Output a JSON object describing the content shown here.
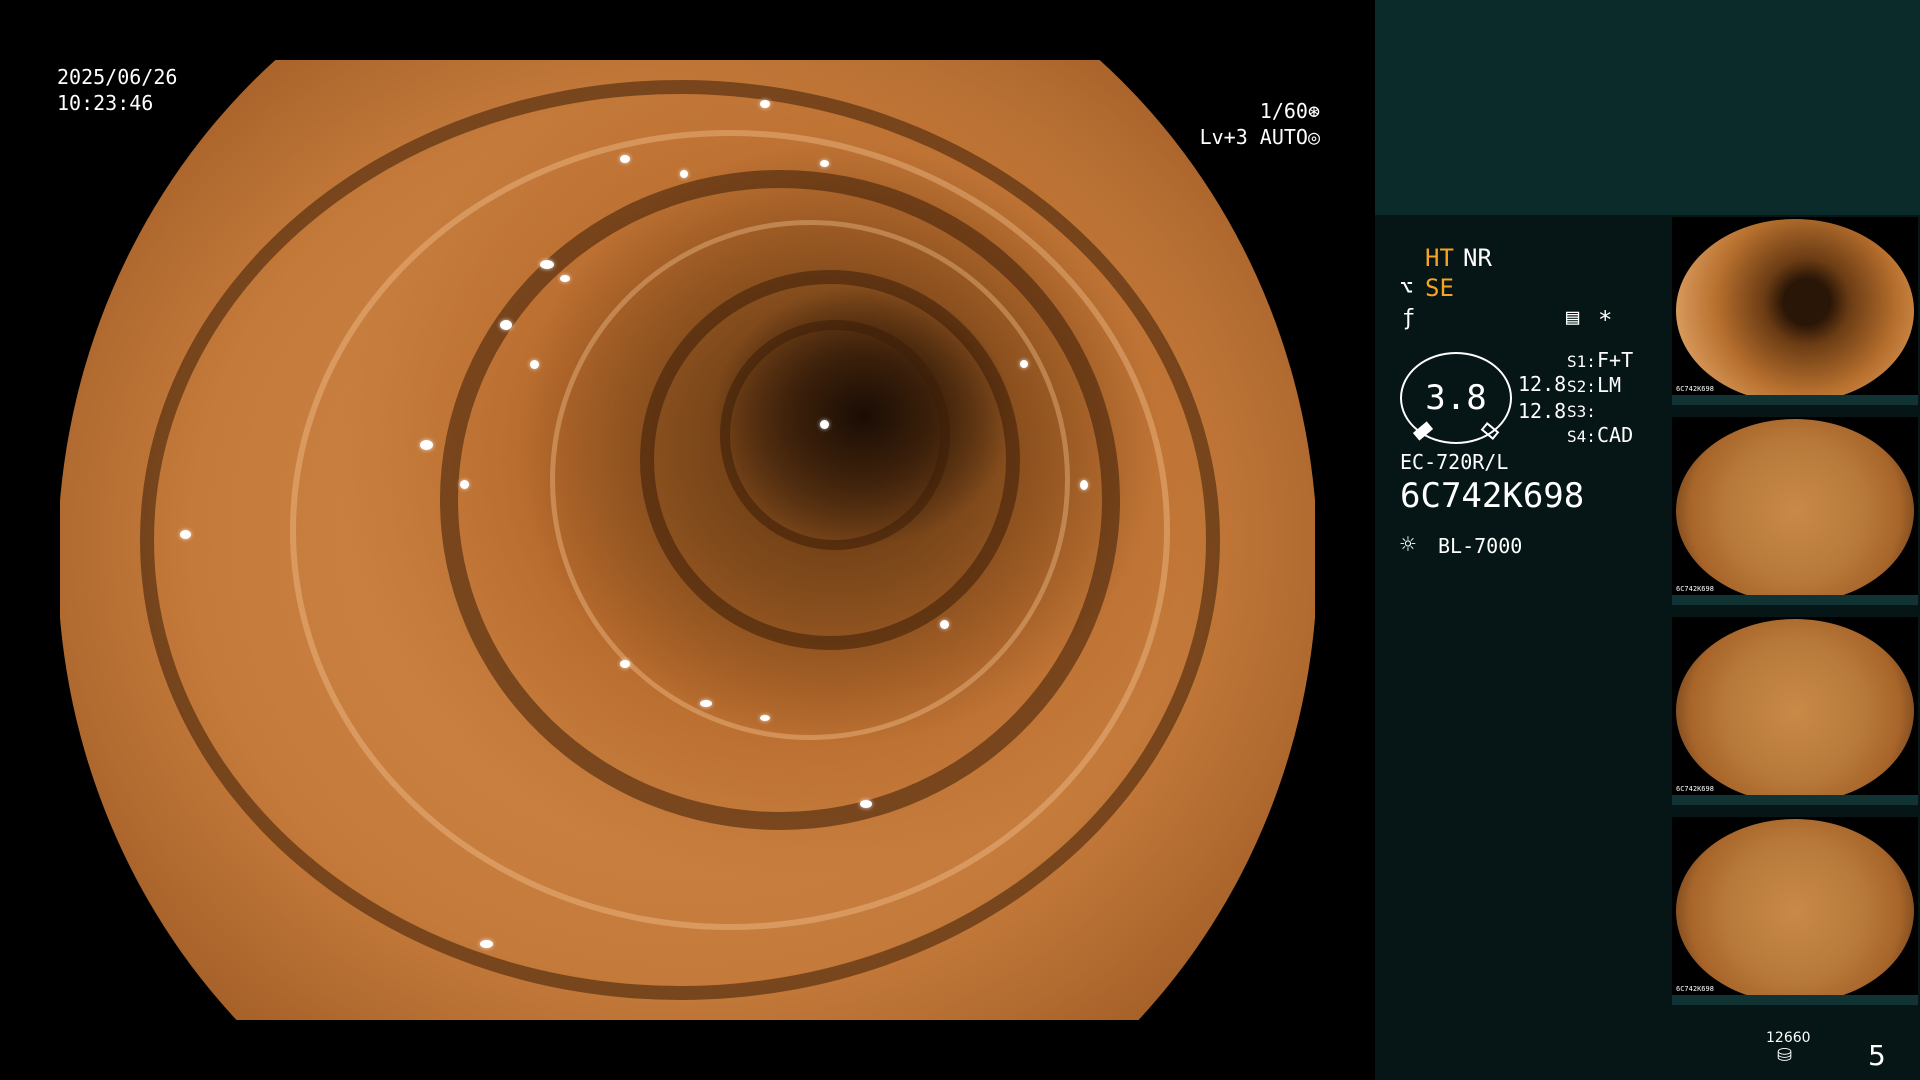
{
  "osd": {
    "date": "2025/06/26",
    "time": "10:23:46",
    "shutter": "1/60",
    "level": "Lv+3 AUTO"
  },
  "settings": {
    "ht": "HT",
    "nr": "NR",
    "se": "SE",
    "dial_value": "3.8",
    "val1": "12.8",
    "val2": "12.8",
    "s1_label": "S1:",
    "s1_value": "F+T",
    "s2_label": "S2:",
    "s2_value": "LM",
    "s3_label": "S3:",
    "s3_value": "",
    "s4_label": "S4:",
    "s4_value": "CAD",
    "asterisk": "*"
  },
  "scope": {
    "model": "EC-720R/L",
    "serial": "6C742K698",
    "light_source": "BL-7000"
  },
  "thumbnails": [
    {
      "label": "6C742K698",
      "style": "dark"
    },
    {
      "label": "6C742K698",
      "style": "light"
    },
    {
      "label": "6C742K698",
      "style": "light"
    },
    {
      "label": "6C742K698",
      "style": "light"
    }
  ],
  "storage": {
    "count": "12660",
    "page": "5"
  },
  "colors": {
    "accent": "#f5a524",
    "panel_top": "#0b2a2a",
    "panel": "#061515"
  },
  "icons": {
    "shutter": "aperture-icon",
    "auto": "iris-icon",
    "enhance": "structure-enhance-icon",
    "color": "color-mode-icon",
    "menu": "document-menu-icon",
    "light": "lamp-icon",
    "storage": "database-icon"
  }
}
